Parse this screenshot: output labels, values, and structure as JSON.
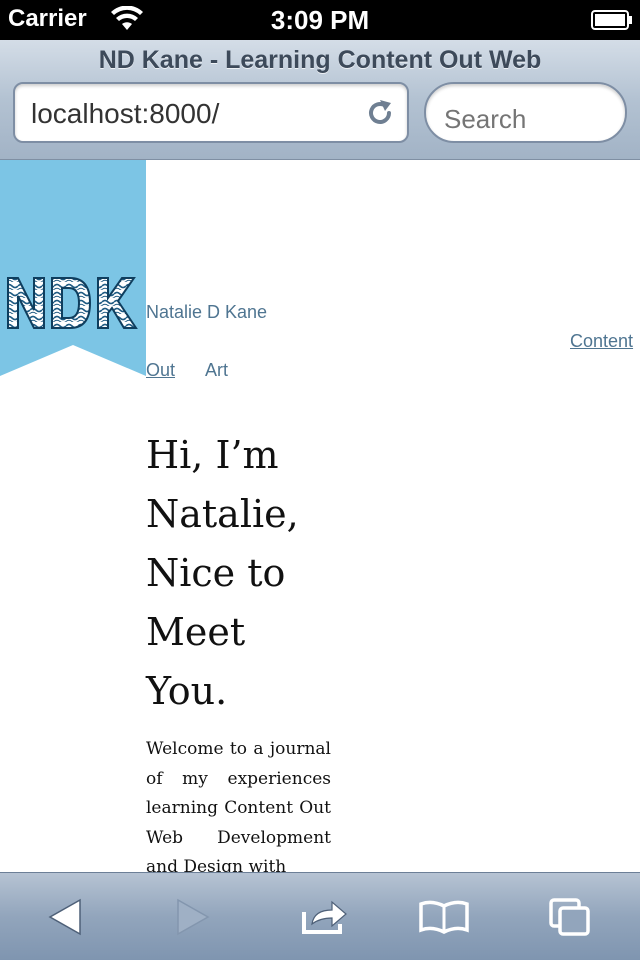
{
  "status_bar": {
    "carrier": "Carrier",
    "time": "3:09 PM",
    "icons": [
      "wifi-icon",
      "battery-icon"
    ]
  },
  "browser": {
    "page_title": "ND Kane - Learning Content Out Web",
    "url": "localhost:8000/",
    "search_placeholder": "Search",
    "icons": [
      "reload-icon"
    ]
  },
  "page": {
    "logo_text": "NDK",
    "site_name": "Natalie D Kane",
    "nav": {
      "content_label": "Content",
      "out_label": "Out",
      "art_label": "Art"
    },
    "hero": {
      "line1": "Hi, I’m",
      "line2": "Natalie,",
      "line3": "Nice to",
      "line4": "Meet",
      "line5": "You."
    },
    "intro": "Welcome to a journal of my experiences learning Content Out Web Development and Design with",
    "colors": {
      "banner": "#7cc5e5",
      "link": "#4f7591"
    }
  },
  "toolbar": {
    "icons": [
      "back-icon",
      "forward-icon",
      "share-icon",
      "bookmarks-icon",
      "pages-icon"
    ]
  }
}
